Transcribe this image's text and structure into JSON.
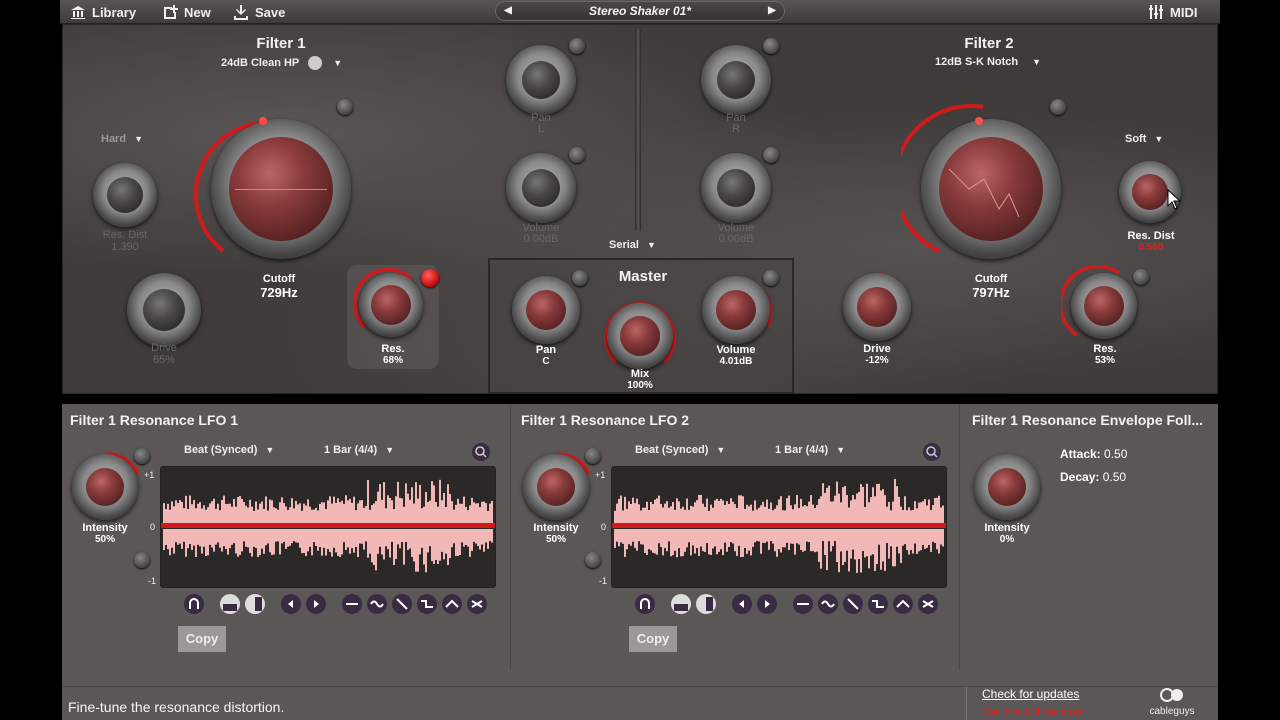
{
  "toolbar": {
    "library_label": "Library",
    "new_label": "New",
    "save_label": "Save",
    "preset_name": "Stereo Shaker 01*",
    "midi_label": "MIDI"
  },
  "filter1": {
    "title": "Filter 1",
    "type": "24dB Clean HP",
    "dist_mode": "Hard",
    "res_dist_label": "Res. Dist",
    "res_dist_value": "1.390",
    "cutoff_label": "Cutoff",
    "cutoff_value": "729Hz",
    "drive_label": "Drive",
    "drive_value": "65%",
    "res_label": "Res.",
    "res_value": "68%"
  },
  "filter2": {
    "title": "Filter 2",
    "type": "12dB S-K Notch",
    "dist_mode": "Soft",
    "res_dist_label": "Res. Dist",
    "res_dist_value": "0.560",
    "cutoff_label": "Cutoff",
    "cutoff_value": "797Hz",
    "drive_label": "Drive",
    "drive_value": "-12%",
    "res_label": "Res.",
    "res_value": "53%"
  },
  "center": {
    "pan_l_label": "Pan",
    "pan_l_value": "L",
    "pan_r_label": "Pan",
    "pan_r_value": "R",
    "vol1_label": "Volume",
    "vol1_value": "0.00dB",
    "vol2_label": "Volume",
    "vol2_value": "0.00dB",
    "routing": "Serial"
  },
  "master": {
    "title": "Master",
    "pan_label": "Pan",
    "pan_value": "C",
    "mix_label": "Mix",
    "mix_value": "100%",
    "volume_label": "Volume",
    "volume_value": "4.01dB"
  },
  "lfo1": {
    "title": "Filter 1 Resonance LFO 1",
    "mode": "Beat (Synced)",
    "length": "1 Bar (4/4)",
    "intensity_label": "Intensity",
    "intensity_value": "50%",
    "axis_top": "+1",
    "axis_mid": "0",
    "axis_bot": "-1",
    "copy_label": "Copy"
  },
  "lfo2": {
    "title": "Filter 1 Resonance LFO 2",
    "mode": "Beat (Synced)",
    "length": "1 Bar (4/4)",
    "intensity_label": "Intensity",
    "intensity_value": "50%",
    "axis_top": "+1",
    "axis_mid": "0",
    "axis_bot": "-1",
    "copy_label": "Copy"
  },
  "envelope": {
    "title": "Filter 1 Resonance Envelope Foll...",
    "attack_label": "Attack:",
    "attack_value": "0.50",
    "decay_label": "Decay:",
    "decay_value": "0.50",
    "intensity_label": "Intensity",
    "intensity_value": "0%"
  },
  "footer": {
    "status": "Fine-tune the resonance distortion.",
    "check_updates": "Check for updates",
    "full_version": "Get the full version!",
    "brand": "cableguys"
  },
  "colors": {
    "accent_red": "#d21a1a",
    "panel": "#3f3b3b",
    "lower_panel": "#5b5757",
    "wave_pink": "#f2b8b8"
  }
}
